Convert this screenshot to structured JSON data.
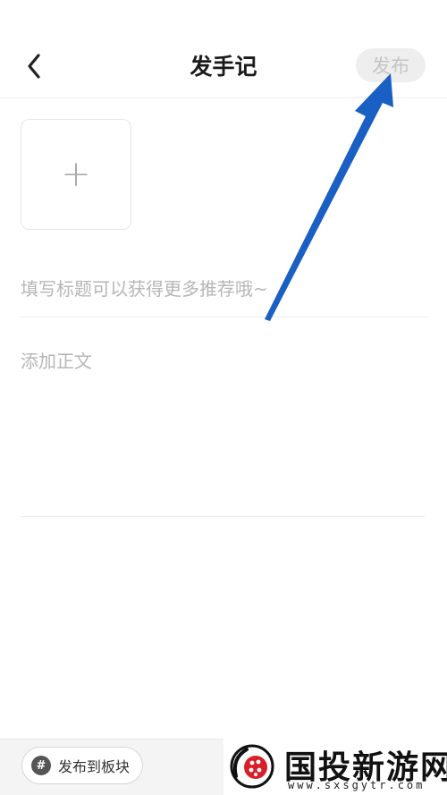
{
  "header": {
    "title": "发手记",
    "publish_label": "发布"
  },
  "editor": {
    "title_placeholder": "填写标题可以获得更多推荐哦~",
    "body_placeholder": "添加正文",
    "add_image_symbol": "+"
  },
  "footer": {
    "board_button_label": "发布到板块",
    "board_icon_glyph": "#"
  },
  "watermark": {
    "name": "国投新游网",
    "url": "www.sxsgytr.com"
  },
  "icons": {
    "back": "chevron-left-icon",
    "board": "hashtag-icon",
    "annotation": "arrow-icon"
  },
  "colors": {
    "annotation_arrow": "#1a5fc4",
    "publish_bg": "#eeeeee",
    "placeholder": "#b6b6b6"
  }
}
